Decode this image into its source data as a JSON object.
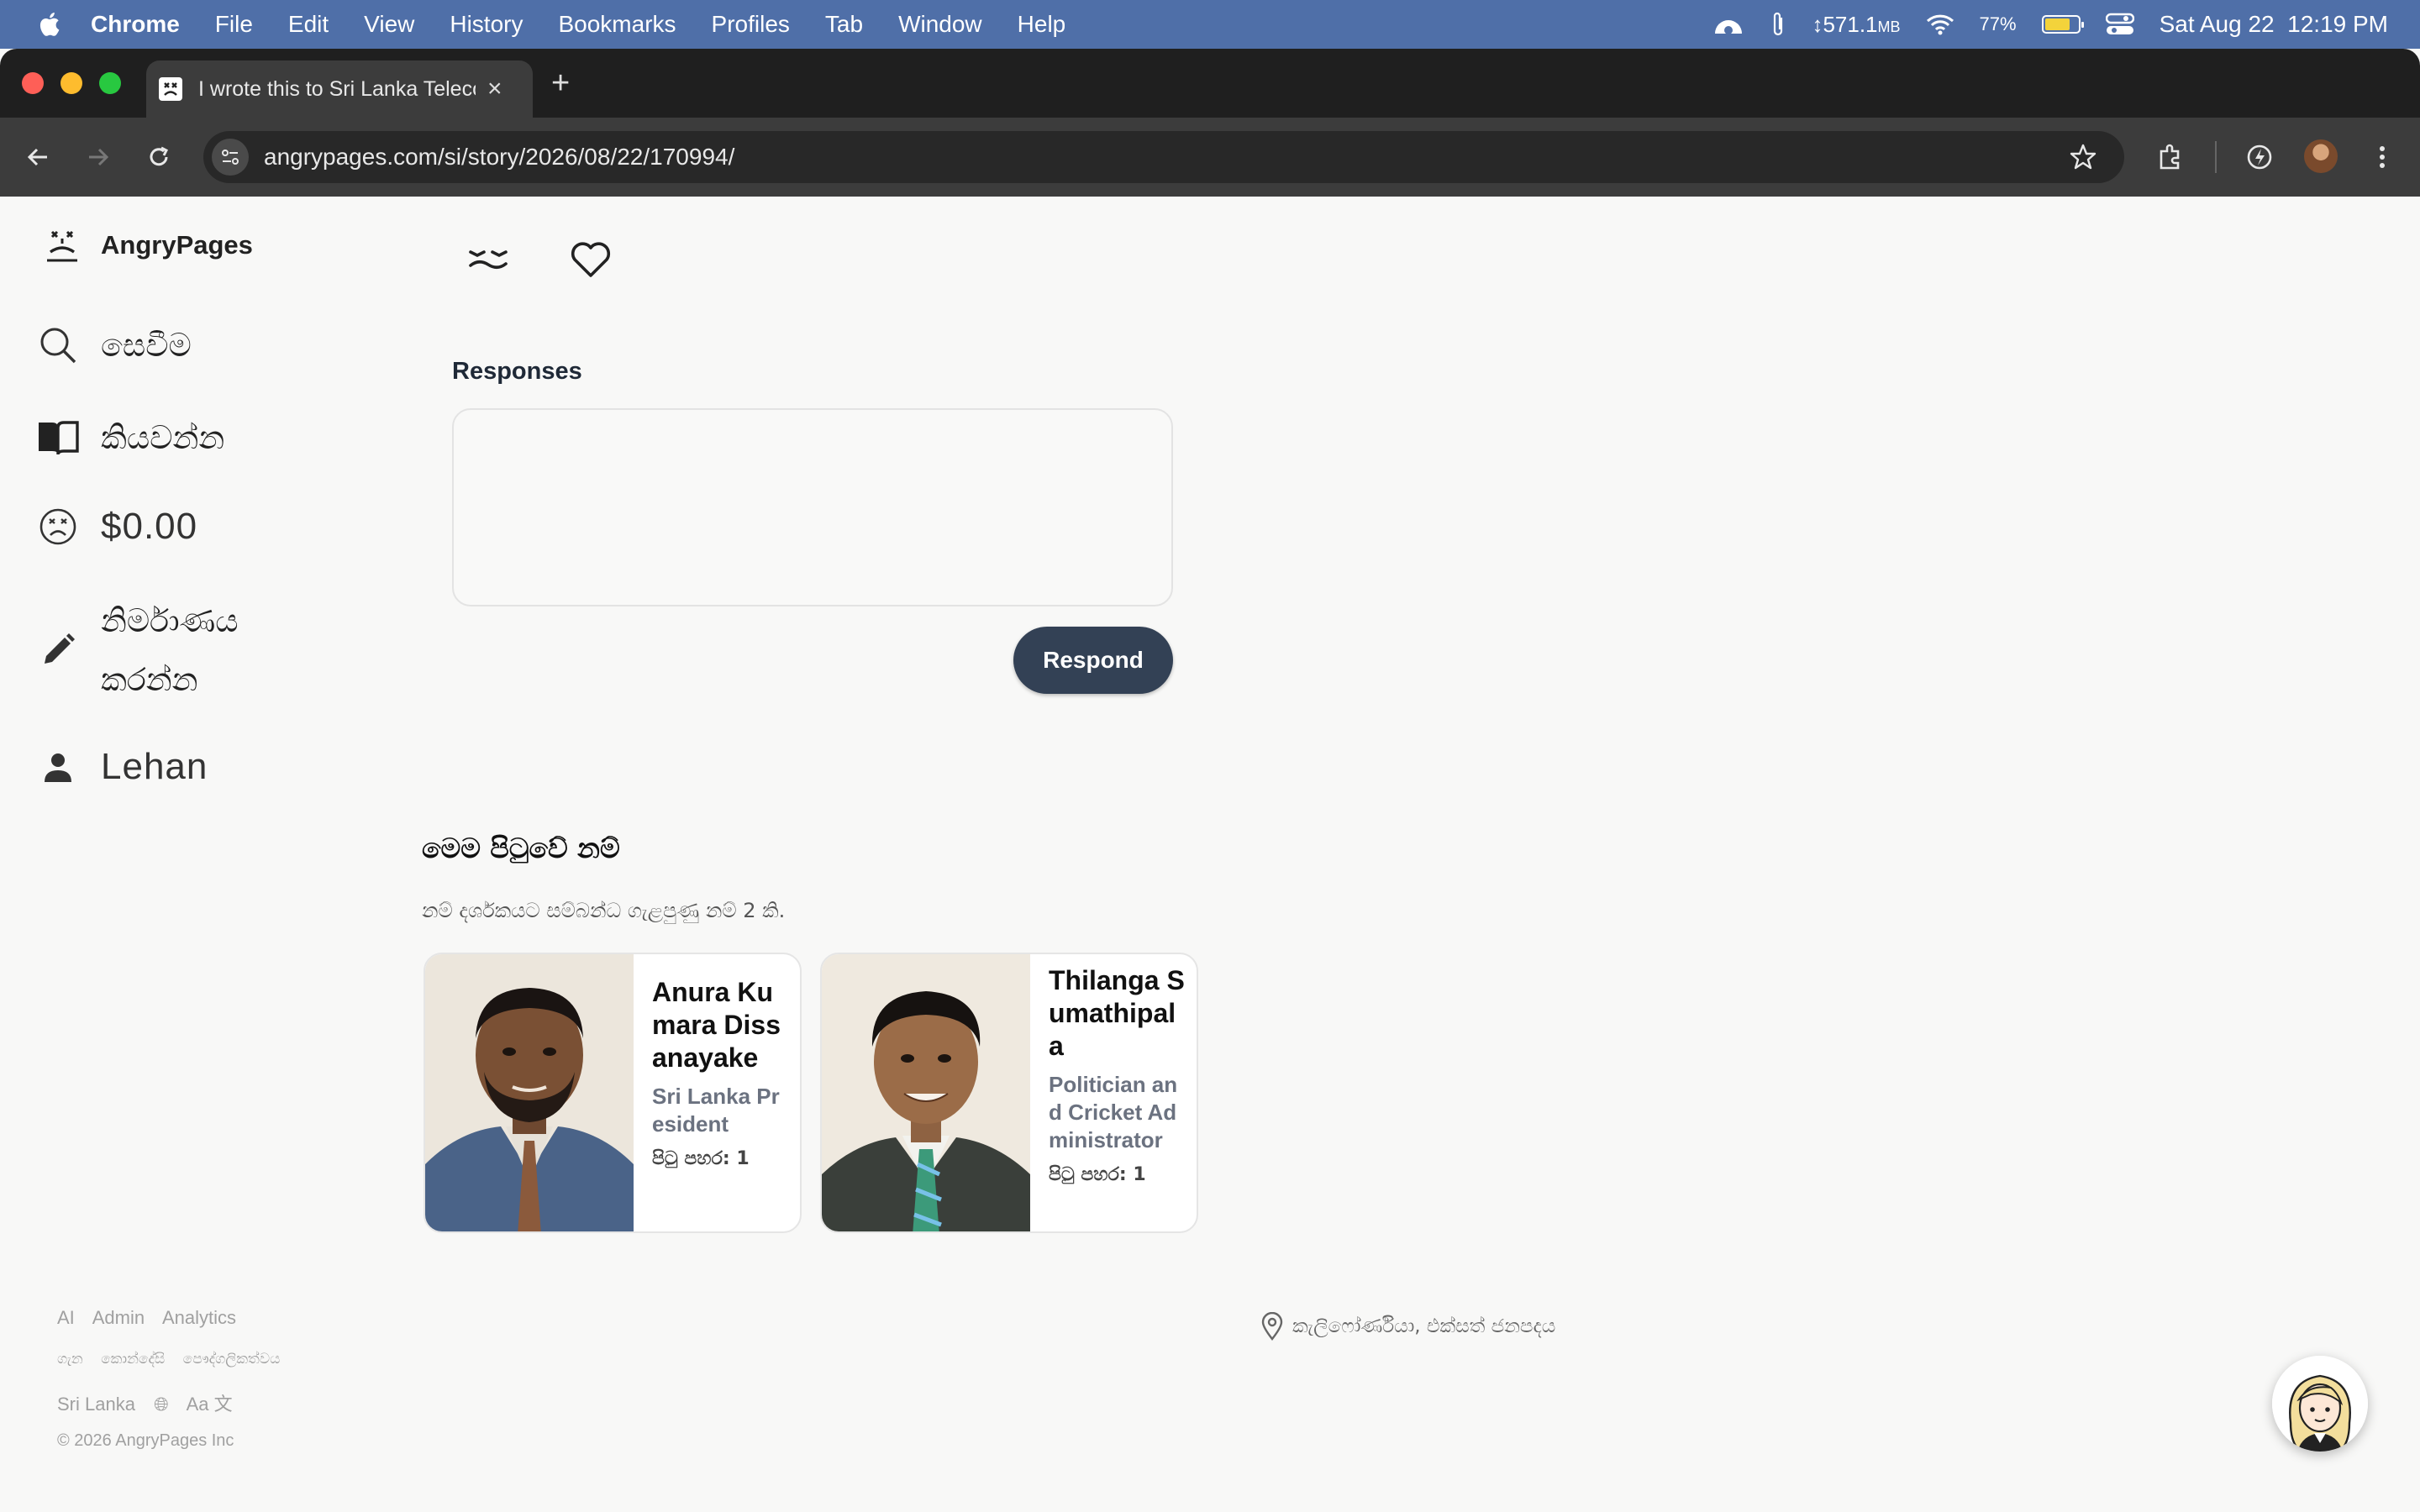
{
  "menubar": {
    "app_name": "Chrome",
    "items": [
      "File",
      "Edit",
      "View",
      "History",
      "Bookmarks",
      "Profiles",
      "Tab",
      "Window",
      "Help"
    ],
    "memory": "571.1",
    "memory_unit": "MB",
    "battery_percent": "77%",
    "battery_level": 0.77,
    "datetime": "Sat Aug 22  12:19 PM"
  },
  "browser": {
    "tab_title": "I wrote this to Sri Lanka Telecom",
    "url": "angrypages.com/si/story/2026/08/22/170994/"
  },
  "sidebar": {
    "brand": "AngryPages",
    "items": [
      {
        "label": "සෙවීම"
      },
      {
        "label": "කියවන්න"
      },
      {
        "label": "$0.00"
      },
      {
        "label": "නිර්මාණය කරන්න"
      },
      {
        "label": "Lehan"
      }
    ]
  },
  "responses": {
    "heading": "Responses",
    "input_value": "",
    "button": "Respond"
  },
  "names": {
    "title": "මෙම පිටුවේ නම්",
    "subtitle": "නම් දර්ශකයට සම්බන්ධ ගැළපුණු නම් 2 කි.",
    "cards": [
      {
        "name": "Anura Kumara Dissanayake",
        "role": "Sri Lanka President",
        "hits": "පිටු පහර: 1"
      },
      {
        "name": "Thilanga Sumathipala",
        "role": "Politician and Cricket Administrator",
        "hits": "පිටු පහර: 1"
      }
    ]
  },
  "footer": {
    "links": [
      "AI",
      "Admin",
      "Analytics"
    ],
    "links2": [
      "ගැන",
      "කොන්දේසි",
      "පෞද්ගලිකත්වය"
    ],
    "country": "Sri Lanka",
    "lang": "Aa 文",
    "copyright": "© 2026 AngryPages Inc",
    "location": "කැලිෆෝර්ණියා, එක්සත් ජනපදය"
  }
}
